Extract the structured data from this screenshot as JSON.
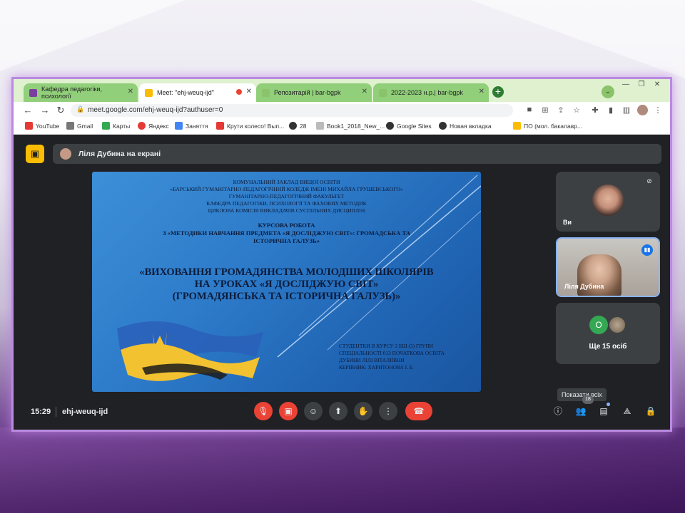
{
  "tabs": [
    {
      "label": "Кафедра педагогіки, психології",
      "fav_color": "#7b3fa0",
      "active": false
    },
    {
      "label": "Meet: \"ehj-weuq-ijd\"",
      "fav_color": "#fbbc04",
      "active": true
    },
    {
      "label": "Репозитарій | bar-bgpk",
      "fav_color": "#8bc36b",
      "active": false
    },
    {
      "label": "2022-2023 н.р.| bar-bgpk",
      "fav_color": "#8bc36b",
      "active": false
    }
  ],
  "address": {
    "url": "meet.google.com/ehj-weuq-ijd?authuser=0"
  },
  "bookmarks": [
    {
      "label": "YouTube",
      "color": "#e53935"
    },
    {
      "label": "Gmail",
      "color": "#777777"
    },
    {
      "label": "Карты",
      "color": "#34a853"
    },
    {
      "label": "Яндекс",
      "color": "#e53935"
    },
    {
      "label": "Заняття",
      "color": "#4285f4"
    },
    {
      "label": "Крути колесо! Вып...",
      "color": "#e53935"
    },
    {
      "label": "28",
      "color": "#333333"
    },
    {
      "label": "Book1_2018_New_...",
      "color": "#bbbbbb"
    },
    {
      "label": "Google Sites",
      "color": "#333333"
    },
    {
      "label": "Новая вкладка",
      "color": "#333333"
    },
    {
      "label": "ПО (мол. бакалавр...",
      "color": "#fbbc04"
    }
  ],
  "meet": {
    "presenting_text": "Ліля Дубина на екрані",
    "time": "15:29",
    "code": "ehj-weuq-ijd",
    "tiles": {
      "you_label": "Ви",
      "speaker_label": "Ліля Дубина",
      "others_avatar_letter": "О",
      "others_label": "Ще 15 осіб"
    },
    "tooltip": "Показати всіх",
    "participants_count": "18"
  },
  "slide": {
    "header_lines": [
      "КОМУНАЛЬНИЙ ЗАКЛАД ВИЩОЇ ОСВІТИ",
      "«БАРСЬКИЙ ГУМАНІТАРНО-ПЕДАГОГІЧНИЙ КОЛЕДЖ ІМЕНІ МИХАЙЛА ГРУШЕВСЬКОГО»",
      "ГУМАНІТАРНО-ПЕДАГОГІЧНИЙ ФАКУЛЬТЕТ",
      "КАФЕДРА ПЕДАГОГІКИ, ПСИХОЛОГІЇ ТА ФАХОВИХ МЕТОДИК",
      "ЦИКЛОВА КОМІСІЯ ВИКЛАДАЧІВ СУСПІЛЬНИХ ДИСЦИПЛІН"
    ],
    "work_lines": [
      "КУРСОВА РОБОТА",
      "З «МЕТОДИКИ НАВЧАННЯ ПРЕДМЕТА «Я ДОСЛІДЖУЮ СВІТ»: ГРОМАДСЬКА ТА",
      "ІСТОРИЧНА ГАЛУЗЬ»"
    ],
    "title_lines": [
      "«ВИХОВАННЯ ГРОМАДЯНСТВА МОЛОДШИХ ШКОЛЯРІВ",
      "НА УРОКАХ «Я ДОСЛІДЖУЮ СВІТ»",
      "(ГРОМАДЯНСЬКА ТА ІСТОРИЧНА ГАЛУЗЬ)»"
    ],
    "footer_lines": [
      "СТУДЕНТКИ II КУРСУ 2 БШ (3) ГРУПИ",
      "СПЕЦІАЛЬНОСТІ 013 ПОЧАТКОВА ОСВІТА",
      "ДУБИНИ ЛІЛІ ВІТАЛІЇВНИ",
      "КЕРІВНИК: ХАРИТОНОВА І. Б."
    ]
  }
}
